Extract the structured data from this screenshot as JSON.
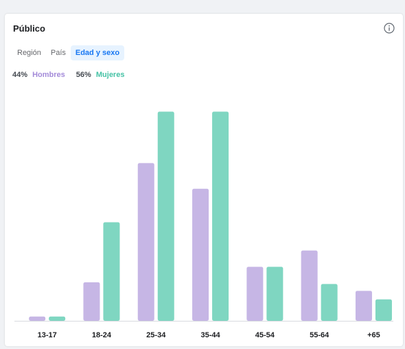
{
  "card": {
    "title": "Público"
  },
  "tabs": [
    {
      "label": "Región",
      "active": false
    },
    {
      "label": "País",
      "active": false
    },
    {
      "label": "Edad y sexo",
      "active": true
    }
  ],
  "legend": {
    "men": {
      "pct": "44%",
      "label": "Hombres"
    },
    "women": {
      "pct": "56%",
      "label": "Mujeres"
    }
  },
  "colors": {
    "men": "#c6b6e5",
    "women": "#7fd6c1",
    "axis": "#d8dadf",
    "tick": "#1c1e21",
    "active_tab": "#1877f2"
  },
  "chart_data": {
    "type": "bar",
    "categories": [
      "13-17",
      "18-24",
      "25-34",
      "35-44",
      "45-54",
      "55-64",
      "+65"
    ],
    "series": [
      {
        "name": "Hombres",
        "values": [
          0.5,
          4.5,
          18.4,
          15.4,
          6.3,
          8.2,
          3.5
        ]
      },
      {
        "name": "Mujeres",
        "values": [
          0.5,
          11.5,
          24.4,
          24.4,
          6.3,
          4.3,
          2.5
        ]
      }
    ],
    "ylim": [
      0,
      25
    ],
    "grid": false
  }
}
